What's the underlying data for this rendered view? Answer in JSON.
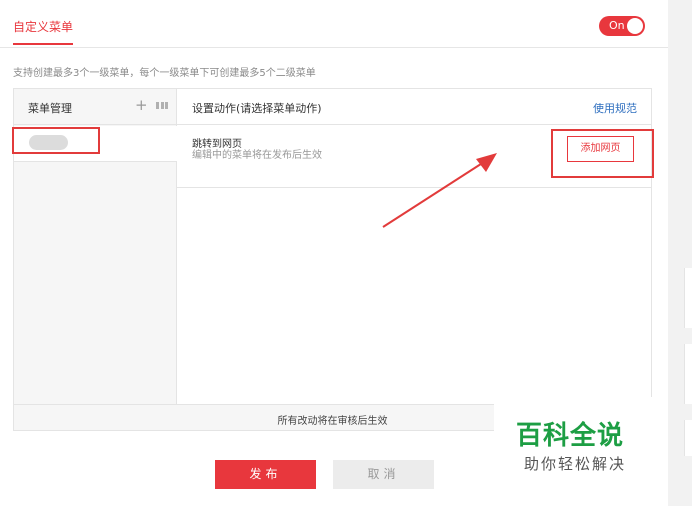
{
  "tabs": {
    "active": "自定义菜单"
  },
  "toggle": {
    "label": "On",
    "state": "on"
  },
  "hint": "支持创建最多3个一级菜单，每个一级菜单下可创建最多5个二级菜单",
  "menu": {
    "header": "菜单管理",
    "add_icon": "plus-icon",
    "sort_icon": "sort-icon"
  },
  "action": {
    "header": "设置动作(请选择菜单动作)",
    "help_link": "使用规范",
    "type_title": "跳转到网页",
    "type_desc": "编辑中的菜单将在发布后生效",
    "add_button": "添加网页"
  },
  "footer_note": "所有改动将在审核后生效",
  "buttons": {
    "publish": "发布",
    "cancel": "取消"
  },
  "watermark": {
    "line1": "百科全说",
    "line2": "助你轻松解决"
  },
  "colors": {
    "accent": "#e8373d",
    "link": "#2f6fbf",
    "watermark": "#1d9e44",
    "annotation": "#e23b3b"
  }
}
